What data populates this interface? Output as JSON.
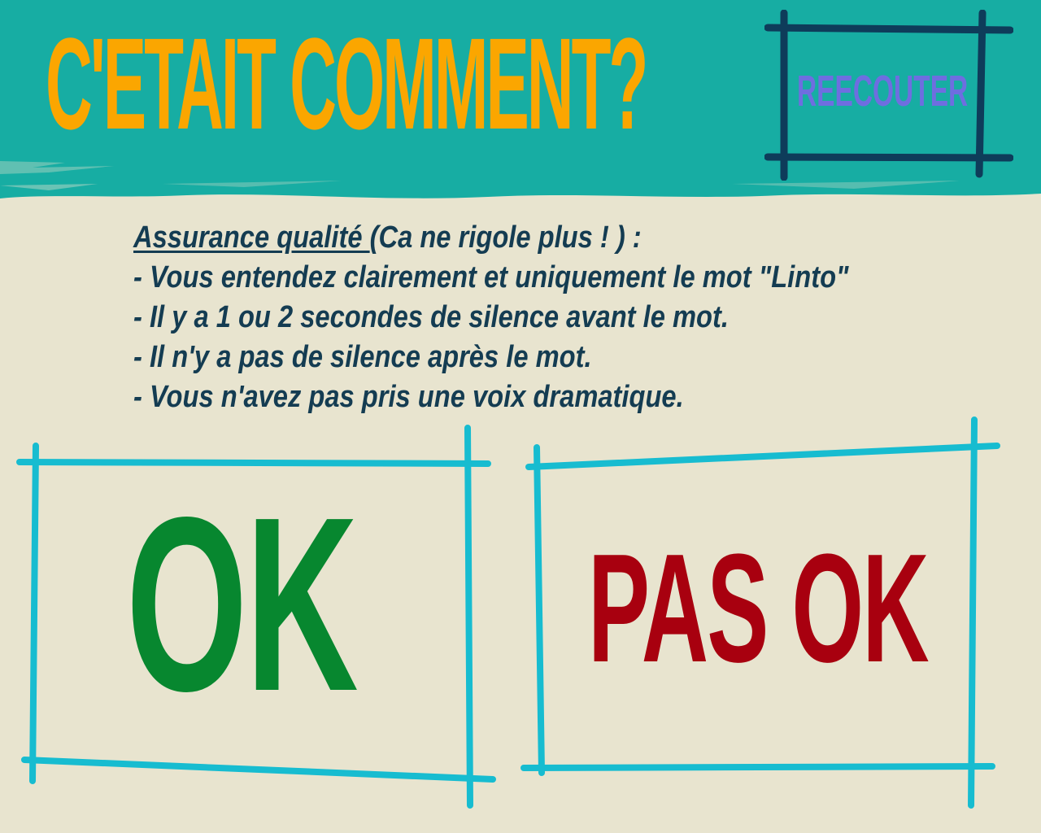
{
  "header": {
    "title": "C'ETAIT COMMENT?",
    "replay_label": "REECOUTER"
  },
  "rules": {
    "heading_underlined": "Assurance qualité ",
    "heading_rest": "(Ca ne rigole plus ! ) :",
    "items": [
      " - Vous entendez clairement et uniquement le mot \"Linto\"",
      " - Il y a 1 ou 2 secondes de silence avant le mot.",
      " - Il n'y a pas de silence après le mot.",
      " - Vous n'avez pas pris une voix dramatique."
    ]
  },
  "choices": {
    "ok_label": "OK",
    "not_ok_label": "PAS OK"
  },
  "colors": {
    "page_background": "#e8e4cf",
    "header_teal": "#17ada3",
    "title_orange": "#fba600",
    "replay_frame": "#0e3c5a",
    "replay_text": "#6e6ee0",
    "body_text": "#143c52",
    "choice_frame": "#17bcd0",
    "ok_green": "#07872f",
    "not_ok_red": "#a8000f"
  }
}
